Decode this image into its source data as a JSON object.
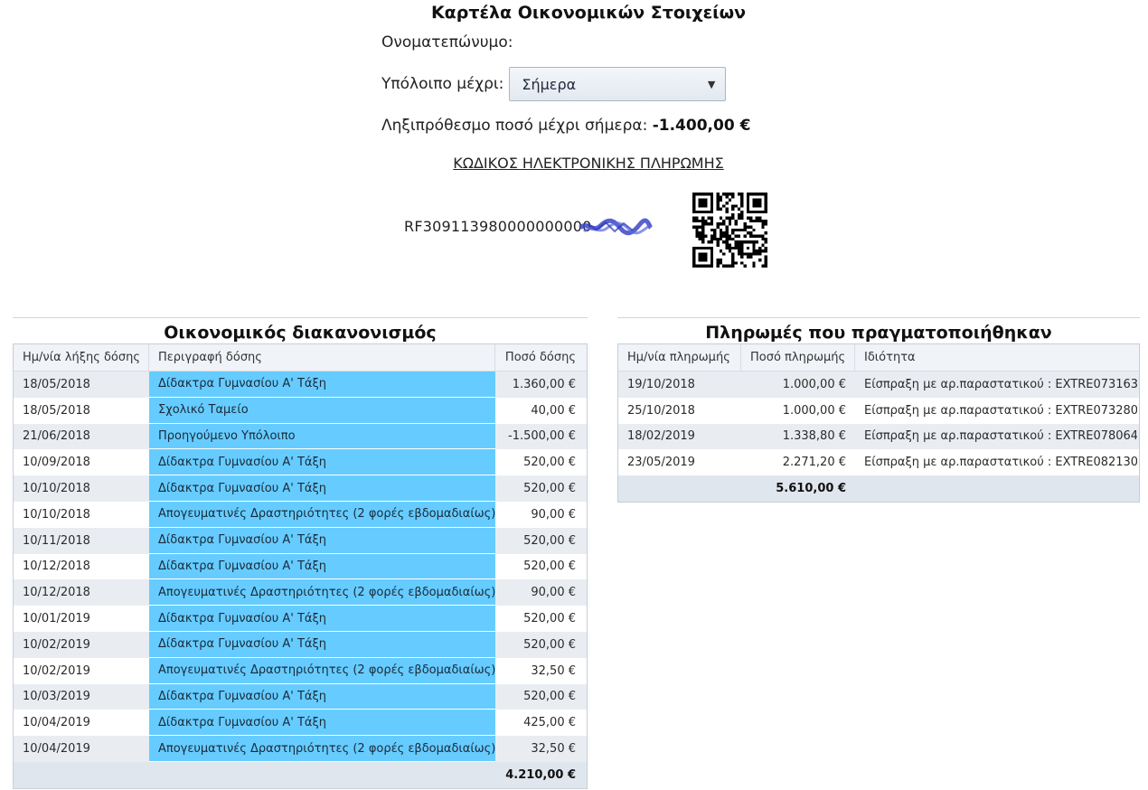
{
  "header": {
    "title": "Καρτέλα Οικονομικών Στοιχείων",
    "name_label": "Ονοματεπώνυμο:",
    "balance_label": "Υπόλοιπο μέχρι:",
    "balance_select_value": "Σήμερα",
    "due_label": "Ληξιπρόθεσμο ποσό μέχρι σήμερα:",
    "due_amount": "-1.400,00 €",
    "payment_code_link": "ΚΩΔΙΚΟΣ ΗΛΕΚΤΡΟΝΙΚΗΣ ΠΛΗΡΩΜΗΣ",
    "rf_code": "RF309113980000000000",
    "icons": {
      "dropdown": "chevron-down-icon",
      "qr": "qr-code-icon"
    }
  },
  "arrangement": {
    "title": "Οικονομικός διακανονισμός",
    "columns": [
      "Ημ/νία λήξης δόσης",
      "Περιγραφή δόσης",
      "Ποσό δόσης"
    ],
    "rows": [
      {
        "date": "18/05/2018",
        "desc": "Δίδακτρα Γυμνασίου Α' Τάξη",
        "amount": "1.360,00 €"
      },
      {
        "date": "18/05/2018",
        "desc": "Σχολικό Ταμείο",
        "amount": "40,00 €"
      },
      {
        "date": "21/06/2018",
        "desc": "Προηγούμενο Υπόλοιπο",
        "amount": "-1.500,00 €"
      },
      {
        "date": "10/09/2018",
        "desc": "Δίδακτρα Γυμνασίου Α' Τάξη",
        "amount": "520,00 €"
      },
      {
        "date": "10/10/2018",
        "desc": "Δίδακτρα Γυμνασίου Α' Τάξη",
        "amount": "520,00 €"
      },
      {
        "date": "10/10/2018",
        "desc": "Απογευματινές Δραστηριότητες (2 φορές εβδομαδιαίως)",
        "amount": "90,00 €"
      },
      {
        "date": "10/11/2018",
        "desc": "Δίδακτρα Γυμνασίου Α' Τάξη",
        "amount": "520,00 €"
      },
      {
        "date": "10/12/2018",
        "desc": "Δίδακτρα Γυμνασίου Α' Τάξη",
        "amount": "520,00 €"
      },
      {
        "date": "10/12/2018",
        "desc": "Απογευματινές Δραστηριότητες (2 φορές εβδομαδιαίως)",
        "amount": "90,00 €"
      },
      {
        "date": "10/01/2019",
        "desc": "Δίδακτρα Γυμνασίου Α' Τάξη",
        "amount": "520,00 €"
      },
      {
        "date": "10/02/2019",
        "desc": "Δίδακτρα Γυμνασίου Α' Τάξη",
        "amount": "520,00 €"
      },
      {
        "date": "10/02/2019",
        "desc": "Απογευματινές Δραστηριότητες (2 φορές εβδομαδιαίως)",
        "amount": "32,50 €"
      },
      {
        "date": "10/03/2019",
        "desc": "Δίδακτρα Γυμνασίου Α' Τάξη",
        "amount": "520,00 €"
      },
      {
        "date": "10/04/2019",
        "desc": "Δίδακτρα Γυμνασίου Α' Τάξη",
        "amount": "425,00 €"
      },
      {
        "date": "10/04/2019",
        "desc": "Απογευματινές Δραστηριότητες (2 φορές εβδομαδιαίως)",
        "amount": "32,50 €"
      }
    ],
    "total": "4.210,00 €"
  },
  "payments": {
    "title": "Πληρωμές που πραγματοποιήθηκαν",
    "columns": [
      "Ημ/νία πληρωμής",
      "Ποσό πληρωμής",
      "Ιδιότητα"
    ],
    "rows": [
      {
        "date": "19/10/2018",
        "amount": "1.000,00 €",
        "type": "Είσπραξη με αρ.παραστατικού : EXTRE073163"
      },
      {
        "date": "25/10/2018",
        "amount": "1.000,00 €",
        "type": "Είσπραξη με αρ.παραστατικού : EXTRE073280"
      },
      {
        "date": "18/02/2019",
        "amount": "1.338,80 €",
        "type": "Είσπραξη με αρ.παραστατικού : EXTRE078064"
      },
      {
        "date": "23/05/2019",
        "amount": "2.271,20 €",
        "type": "Είσπραξη με αρ.παραστατικού : EXTRE082130"
      }
    ],
    "total": "5.610,00 €"
  }
}
